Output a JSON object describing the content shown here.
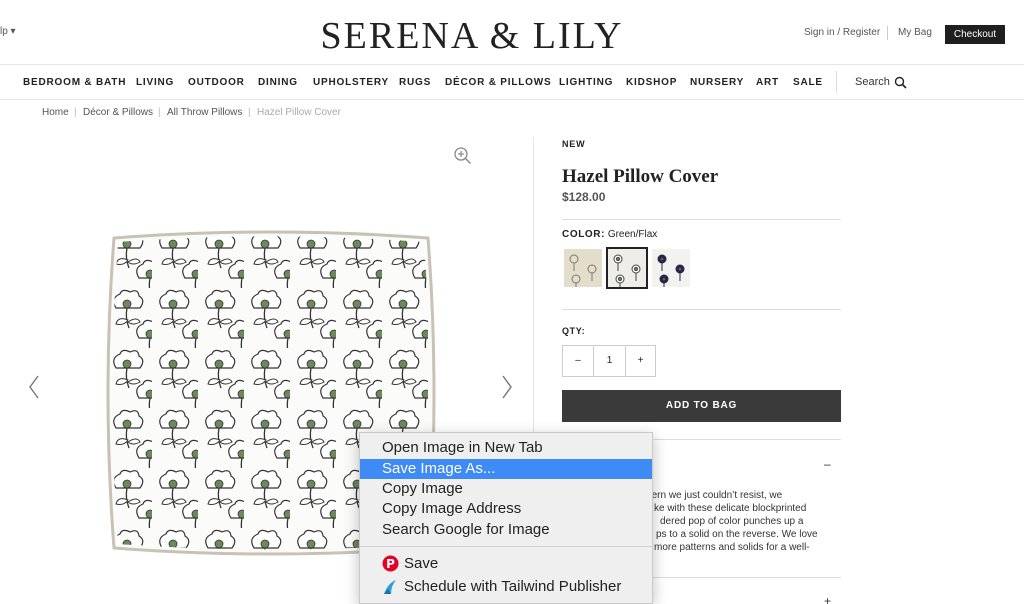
{
  "header": {
    "help_fragment": "lp ▾",
    "logo": "SERENA & LILY",
    "sign_in": "Sign in / Register",
    "my_bag": "My Bag",
    "checkout": "Checkout"
  },
  "nav": {
    "items": [
      "BEDROOM & BATH",
      "LIVING",
      "OUTDOOR",
      "DINING",
      "UPHOLSTERY",
      "RUGS",
      "DÉCOR & PILLOWS",
      "LIGHTING",
      "KIDSHOP",
      "NURSERY",
      "ART",
      "SALE"
    ],
    "search_label": "Search"
  },
  "breadcrumb": {
    "items": [
      "Home",
      "Décor & Pillows",
      "All Throw Pillows",
      "Hazel Pillow Cover"
    ],
    "separator": "|"
  },
  "product": {
    "badge": "NEW",
    "title": "Hazel Pillow Cover",
    "price": "$128.00",
    "color_label": "COLOR:",
    "color_value": "Green/Flax",
    "swatches": [
      "flax",
      "green-flax",
      "navy-red"
    ],
    "selected_swatch": 1,
    "qty_label": "QTY:",
    "qty_minus": "–",
    "qty_value": "1",
    "qty_plus": "+",
    "add_to_bag": "ADD TO BAG",
    "accordion_collapse": "–",
    "accordion_expand": "+",
    "description_lines": [
      "ge pattern we just couldn’t resist, we",
      "ke with these delicate blockprinted",
      "dered pop of color punches up a",
      "ps to a solid on the reverse. We love",
      " more patterns and solids for a well-"
    ]
  },
  "context_menu": {
    "items": [
      "Open Image in New Tab",
      "Save Image As...",
      "Copy Image",
      "Copy Image Address",
      "Search Google for Image"
    ],
    "highlighted_index": 1,
    "extensions": [
      "Save",
      "Schedule with Tailwind Publisher"
    ]
  },
  "colors": {
    "highlight": "#3f8bf5",
    "button_dark": "#3a3a3a",
    "pinterest": "#e60023",
    "tailwind": "#2b9fd8"
  },
  "icons": {
    "zoom": "zoom-in-icon",
    "prev": "chevron-left-icon",
    "next": "chevron-right-icon",
    "search": "search-icon",
    "pinterest": "pinterest-icon",
    "tailwind": "tailwind-icon"
  }
}
